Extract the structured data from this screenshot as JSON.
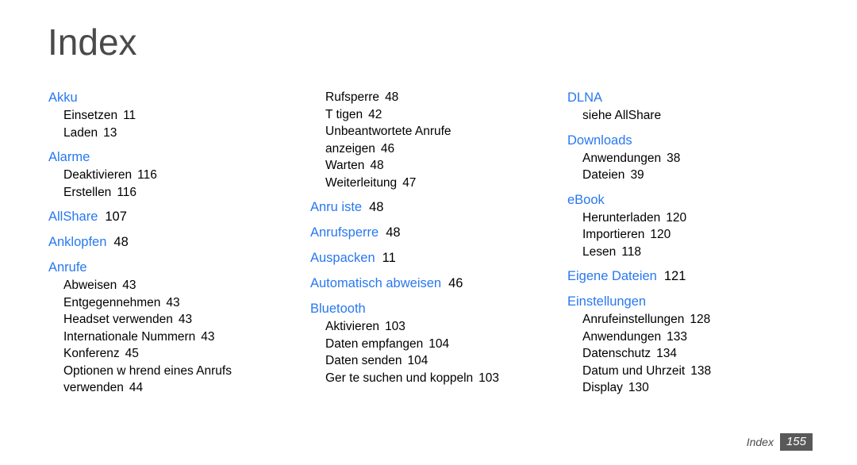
{
  "title": "Index",
  "colors": {
    "heading_blue": "#2878F0",
    "title_gray": "#4A4A4A",
    "body_black": "#000000",
    "footer_badge": "#595959"
  },
  "columns": [
    {
      "groups": [
        {
          "heading": "Akku",
          "heading_page": "",
          "subentries": [
            {
              "label": "Einsetzen",
              "page": "11"
            },
            {
              "label": "Laden",
              "page": "13"
            }
          ]
        },
        {
          "heading": "Alarme",
          "heading_page": "",
          "subentries": [
            {
              "label": "Deaktivieren",
              "page": "116"
            },
            {
              "label": "Erstellen",
              "page": "116"
            }
          ]
        },
        {
          "heading": "AllShare",
          "heading_page": "107",
          "subentries": []
        },
        {
          "heading": "Anklopfen",
          "heading_page": "48",
          "subentries": []
        },
        {
          "heading": "Anrufe",
          "heading_page": "",
          "subentries": [
            {
              "label": "Abweisen",
              "page": "43"
            },
            {
              "label": "Entgegennehmen",
              "page": "43"
            },
            {
              "label": "Headset verwenden",
              "page": "43"
            },
            {
              "label": "Internationale Nummern",
              "page": "43"
            },
            {
              "label": "Konferenz",
              "page": "45"
            },
            {
              "label": "Optionen w hrend eines Anrufs",
              "page": ""
            },
            {
              "label": "verwenden",
              "page": "44"
            }
          ]
        }
      ]
    },
    {
      "groups": [
        {
          "heading": "",
          "heading_page": "",
          "subentries": [
            {
              "label": "Rufsperre",
              "page": "48"
            },
            {
              "label": "T tigen",
              "page": "42"
            },
            {
              "label": "Unbeantwortete Anrufe",
              "page": ""
            },
            {
              "label": "anzeigen",
              "page": "46"
            },
            {
              "label": "Warten",
              "page": "48"
            },
            {
              "label": "Weiterleitung",
              "page": "47"
            }
          ]
        },
        {
          "heading": "Anru iste",
          "heading_page": "48",
          "subentries": []
        },
        {
          "heading": "Anrufsperre",
          "heading_page": "48",
          "subentries": []
        },
        {
          "heading": "Auspacken",
          "heading_page": "11",
          "subentries": []
        },
        {
          "heading": "Automatisch abweisen",
          "heading_page": "46",
          "subentries": []
        },
        {
          "heading": "Bluetooth",
          "heading_page": "",
          "subentries": [
            {
              "label": "Aktivieren",
              "page": "103"
            },
            {
              "label": "Daten empfangen",
              "page": "104"
            },
            {
              "label": "Daten senden",
              "page": "104"
            },
            {
              "label": "Ger te suchen und koppeln",
              "page": "103"
            }
          ]
        }
      ]
    },
    {
      "groups": [
        {
          "heading": "DLNA",
          "heading_page": "",
          "subentries": [
            {
              "label": "siehe  AllShare",
              "page": ""
            }
          ]
        },
        {
          "heading": "Downloads",
          "heading_page": "",
          "subentries": [
            {
              "label": "Anwendungen",
              "page": "38"
            },
            {
              "label": "Dateien",
              "page": "39"
            }
          ]
        },
        {
          "heading": "eBook",
          "heading_page": "",
          "subentries": [
            {
              "label": "Herunterladen",
              "page": "120"
            },
            {
              "label": "Importieren",
              "page": "120"
            },
            {
              "label": "Lesen",
              "page": "118"
            }
          ]
        },
        {
          "heading": "Eigene Dateien",
          "heading_page": "121",
          "subentries": []
        },
        {
          "heading": "Einstellungen",
          "heading_page": "",
          "subentries": [
            {
              "label": "Anrufeinstellungen",
              "page": "128"
            },
            {
              "label": "Anwendungen",
              "page": "133"
            },
            {
              "label": "Datenschutz",
              "page": "134"
            },
            {
              "label": "Datum und Uhrzeit",
              "page": "138"
            },
            {
              "label": "Display",
              "page": "130"
            }
          ]
        }
      ]
    }
  ],
  "footer": {
    "label": "Index",
    "page_number": "155"
  }
}
